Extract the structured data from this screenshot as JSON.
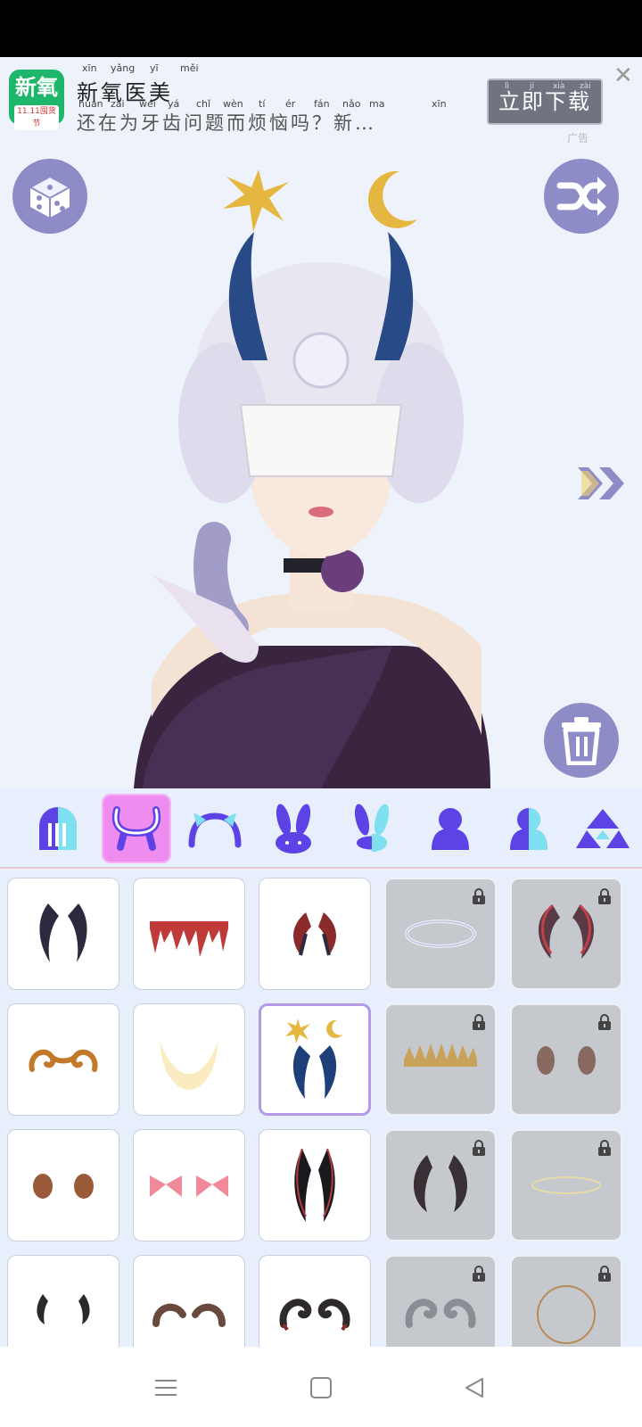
{
  "ad": {
    "logo_text": "新氧",
    "logo_sub": "11.11囤货节",
    "title": "新氧医美",
    "title_pinyin": [
      "xīn",
      "yǎng",
      "yī",
      "měi"
    ],
    "description": "还在为牙齿问题而烦恼吗？新…",
    "description_pinyin": [
      "huán",
      "zài",
      "wéi",
      "yá",
      "chǐ",
      "wèn",
      "tí",
      "ér",
      "fán",
      "nǎo",
      "ma",
      "xīn"
    ],
    "cta_label": "立即下载",
    "cta_pinyin": [
      "lì",
      "jí",
      "xià",
      "zài"
    ],
    "close_icon": "close-icon",
    "brand_mark": "广告"
  },
  "canvas": {
    "random_button_icon": "dice-icon",
    "shuffle_button_icon": "shuffle-icon",
    "next_icon": "double-chevron-right-icon",
    "delete_icon": "trash-icon"
  },
  "tabs": [
    {
      "name": "tab-hair",
      "icon": "hair-icon",
      "active": false
    },
    {
      "name": "tab-horns",
      "icon": "horns-icon",
      "active": true
    },
    {
      "name": "tab-headband",
      "icon": "headband-icon",
      "active": false
    },
    {
      "name": "tab-bunny-ears",
      "icon": "bunny-ears-icon",
      "active": false
    },
    {
      "name": "tab-ears-alt",
      "icon": "ears-alt-icon",
      "active": false
    },
    {
      "name": "tab-body",
      "icon": "body-icon",
      "active": false
    },
    {
      "name": "tab-body-alt",
      "icon": "body-alt-icon",
      "active": false
    },
    {
      "name": "tab-triangles",
      "icon": "triangles-icon",
      "active": false
    }
  ],
  "items": [
    {
      "name": "dark-horns",
      "locked": false,
      "selected": false
    },
    {
      "name": "blood-crown",
      "locked": false,
      "selected": false
    },
    {
      "name": "red-wings-horns",
      "locked": false,
      "selected": false
    },
    {
      "name": "halo-ring",
      "locked": true,
      "selected": false
    },
    {
      "name": "red-curved-horns",
      "locked": true,
      "selected": false
    },
    {
      "name": "golden-ram-horns",
      "locked": false,
      "selected": false
    },
    {
      "name": "crescent-moon",
      "locked": false,
      "selected": false
    },
    {
      "name": "star-moon-horns",
      "locked": false,
      "selected": true
    },
    {
      "name": "golden-spike-crown",
      "locked": true,
      "selected": false
    },
    {
      "name": "small-brown-horns",
      "locked": true,
      "selected": false
    },
    {
      "name": "copper-knobs",
      "locked": false,
      "selected": false
    },
    {
      "name": "pink-bows",
      "locked": false,
      "selected": false
    },
    {
      "name": "black-red-horns",
      "locked": false,
      "selected": false
    },
    {
      "name": "curled-demon-horns",
      "locked": true,
      "selected": false
    },
    {
      "name": "thin-halo",
      "locked": true,
      "selected": false
    },
    {
      "name": "small-black-horns",
      "locked": false,
      "selected": false
    },
    {
      "name": "brown-curled-horns",
      "locked": false,
      "selected": false
    },
    {
      "name": "dark-red-ram-horns",
      "locked": false,
      "selected": false
    },
    {
      "name": "silver-ram-horns",
      "locked": true,
      "selected": false
    },
    {
      "name": "gold-ring",
      "locked": true,
      "selected": false
    }
  ],
  "navbar": {
    "menu_icon": "menu-icon",
    "home_icon": "home-square-icon",
    "back_icon": "back-triangle-icon"
  }
}
